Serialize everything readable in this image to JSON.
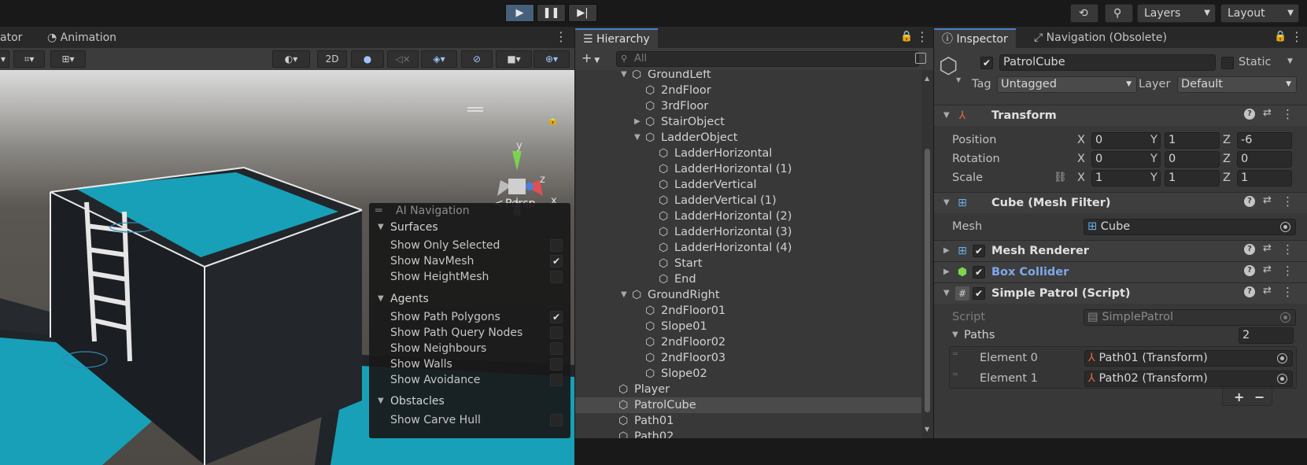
{
  "toolbar": {
    "play_icon": "play-icon",
    "pause_icon": "pause-icon",
    "step_icon": "step-icon",
    "layers_label": "Layers",
    "layout_label": "Layout"
  },
  "scene": {
    "tab_partial": "ator",
    "tab_animation": "Animation",
    "btn_2d": "2D",
    "persp_label": "Persp",
    "gizmo": {
      "y": "y",
      "z": "z",
      "x": "x"
    }
  },
  "ai_navigation": {
    "title": "AI Navigation",
    "sections": [
      {
        "name": "Surfaces",
        "items": [
          {
            "label": "Show Only Selected",
            "checked": false
          },
          {
            "label": "Show NavMesh",
            "checked": true
          },
          {
            "label": "Show HeightMesh",
            "checked": false
          }
        ]
      },
      {
        "name": "Agents",
        "items": [
          {
            "label": "Show Path Polygons",
            "checked": true
          },
          {
            "label": "Show Path Query Nodes",
            "checked": false
          },
          {
            "label": "Show Neighbours",
            "checked": false
          },
          {
            "label": "Show Walls",
            "checked": false
          },
          {
            "label": "Show Avoidance",
            "checked": false
          }
        ]
      },
      {
        "name": "Obstacles",
        "items": [
          {
            "label": "Show Carve Hull",
            "checked": false
          }
        ]
      }
    ]
  },
  "hierarchy": {
    "tab_label": "Hierarchy",
    "search_placeholder": "All",
    "add_label": "+",
    "rows": [
      {
        "label": "GroundLeft",
        "depth": 3,
        "expand": "open"
      },
      {
        "label": "2ndFloor",
        "depth": 4,
        "expand": "none"
      },
      {
        "label": "3rdFloor",
        "depth": 4,
        "expand": "none"
      },
      {
        "label": "StairObject",
        "depth": 4,
        "expand": "closed"
      },
      {
        "label": "LadderObject",
        "depth": 4,
        "expand": "open"
      },
      {
        "label": "LadderHorizontal",
        "depth": 5,
        "expand": "none"
      },
      {
        "label": "LadderHorizontal (1)",
        "depth": 5,
        "expand": "none"
      },
      {
        "label": "LadderVertical",
        "depth": 5,
        "expand": "none"
      },
      {
        "label": "LadderVertical (1)",
        "depth": 5,
        "expand": "none"
      },
      {
        "label": "LadderHorizontal (2)",
        "depth": 5,
        "expand": "none"
      },
      {
        "label": "LadderHorizontal (3)",
        "depth": 5,
        "expand": "none"
      },
      {
        "label": "LadderHorizontal (4)",
        "depth": 5,
        "expand": "none"
      },
      {
        "label": "Start",
        "depth": 5,
        "expand": "none"
      },
      {
        "label": "End",
        "depth": 5,
        "expand": "none"
      },
      {
        "label": "GroundRight",
        "depth": 3,
        "expand": "open"
      },
      {
        "label": "2ndFloor01",
        "depth": 4,
        "expand": "none"
      },
      {
        "label": "Slope01",
        "depth": 4,
        "expand": "none"
      },
      {
        "label": "2ndFloor02",
        "depth": 4,
        "expand": "none"
      },
      {
        "label": "2ndFloor03",
        "depth": 4,
        "expand": "none"
      },
      {
        "label": "Slope02",
        "depth": 4,
        "expand": "none"
      },
      {
        "label": "Player",
        "depth": 2,
        "expand": "none"
      },
      {
        "label": "PatrolCube",
        "depth": 2,
        "expand": "none",
        "selected": true
      },
      {
        "label": "Path01",
        "depth": 2,
        "expand": "none"
      },
      {
        "label": "Path02",
        "depth": 2,
        "expand": "none"
      }
    ]
  },
  "inspector": {
    "tab_inspector": "Inspector",
    "tab_navigation": "Navigation (Obsolete)",
    "object_name": "PatrolCube",
    "static_label": "Static",
    "tag_label": "Tag",
    "tag_value": "Untagged",
    "layer_label": "Layer",
    "layer_value": "Default",
    "transform": {
      "title": "Transform",
      "position_label": "Position",
      "rotation_label": "Rotation",
      "scale_label": "Scale",
      "position": {
        "x": "0",
        "y": "1",
        "z": "-6"
      },
      "rotation": {
        "x": "0",
        "y": "0",
        "z": "0"
      },
      "scale": {
        "x": "1",
        "y": "1",
        "z": "1"
      },
      "axis_x": "X",
      "axis_y": "Y",
      "axis_z": "Z"
    },
    "mesh_filter": {
      "title": "Cube (Mesh Filter)",
      "mesh_label": "Mesh",
      "mesh_value": "Cube"
    },
    "mesh_renderer": {
      "title": "Mesh Renderer"
    },
    "box_collider": {
      "title": "Box Collider",
      "color": "#7ea8ec"
    },
    "simple_patrol": {
      "title": "Simple Patrol (Script)",
      "script_label": "Script",
      "script_value": "SimplePatrol",
      "paths_label": "Paths",
      "paths_count": "2",
      "elements": [
        {
          "label": "Element 0",
          "value": "Path01 (Transform)"
        },
        {
          "label": "Element 1",
          "value": "Path02 (Transform)"
        }
      ],
      "add_label": "+",
      "remove_label": "−"
    }
  },
  "colors": {
    "navmesh": "#17a0b8",
    "accent": "#4a80c8"
  }
}
